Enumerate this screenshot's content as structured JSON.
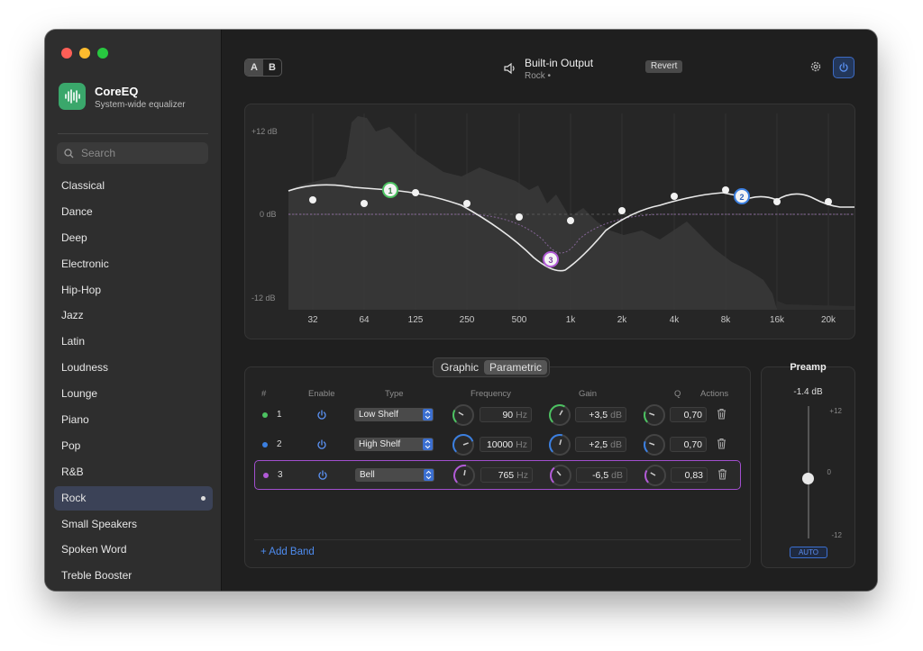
{
  "app": {
    "name": "CoreEQ",
    "subtitle": "System-wide equalizer"
  },
  "search": {
    "placeholder": "Search"
  },
  "presets": [
    {
      "label": "Classical"
    },
    {
      "label": "Dance"
    },
    {
      "label": "Deep"
    },
    {
      "label": "Electronic"
    },
    {
      "label": "Hip-Hop"
    },
    {
      "label": "Jazz"
    },
    {
      "label": "Latin"
    },
    {
      "label": "Loudness"
    },
    {
      "label": "Lounge"
    },
    {
      "label": "Piano"
    },
    {
      "label": "Pop"
    },
    {
      "label": "R&B"
    },
    {
      "label": "Rock",
      "active": true
    },
    {
      "label": "Small Speakers"
    },
    {
      "label": "Spoken Word"
    },
    {
      "label": "Treble Booster"
    }
  ],
  "toolbar": {
    "ab_a": "A",
    "ab_b": "B",
    "output_title": "Built-in Output",
    "output_preset": "Rock •",
    "revert_label": "Revert"
  },
  "graph": {
    "y_labels": [
      "+12 dB",
      "0 dB",
      "-12 dB"
    ],
    "freq_labels": [
      "32",
      "64",
      "125",
      "250",
      "500",
      "1k",
      "2k",
      "4k",
      "8k",
      "16k",
      "20k"
    ],
    "band_markers": [
      "1",
      "2",
      "3"
    ]
  },
  "tabs": {
    "graphic": "Graphic",
    "parametric": "Parametric"
  },
  "band_table": {
    "headers": {
      "num": "#",
      "enable": "Enable",
      "type": "Type",
      "frequency": "Frequency",
      "gain": "Gain",
      "q": "Q",
      "actions": "Actions"
    },
    "rows": [
      {
        "num": "1",
        "type": "Low Shelf",
        "freq": "90",
        "freq_unit": "Hz",
        "gain": "+3,5",
        "gain_unit": "dB",
        "q": "0,70",
        "color": "#4cc261"
      },
      {
        "num": "2",
        "type": "High Shelf",
        "freq": "10000",
        "freq_unit": "Hz",
        "gain": "+2,5",
        "gain_unit": "dB",
        "q": "0,70",
        "color": "#3b7fe0"
      },
      {
        "num": "3",
        "type": "Bell",
        "freq": "765",
        "freq_unit": "Hz",
        "gain": "-6,5",
        "gain_unit": "dB",
        "q": "0,83",
        "color": "#b15ad6"
      }
    ],
    "add_band": "+ Add Band"
  },
  "preamp": {
    "title": "Preamp",
    "value": "-1.4 dB",
    "tick_top": "+12",
    "tick_mid": "0",
    "tick_bottom": "-12",
    "auto_label": "AUTO"
  }
}
